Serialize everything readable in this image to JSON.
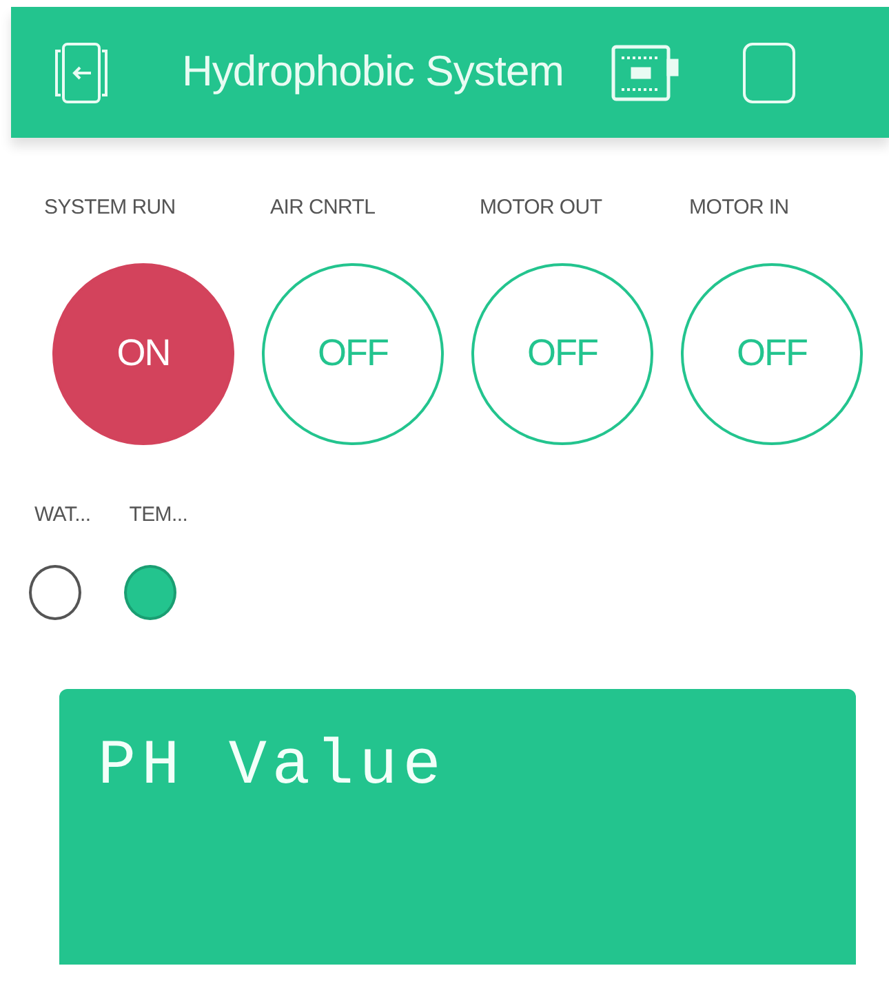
{
  "header": {
    "title": "Hydrophobic System"
  },
  "buttons": [
    {
      "label": "SYSTEM RUN",
      "text": "ON",
      "on": true
    },
    {
      "label": "AIR CNRTL",
      "text": "OFF",
      "on": false
    },
    {
      "label": "MOTOR OUT",
      "text": "OFF",
      "on": false
    },
    {
      "label": "MOTOR IN",
      "text": "OFF",
      "on": false
    }
  ],
  "leds": [
    {
      "label": "WAT...",
      "on": false
    },
    {
      "label": "TEM...",
      "on": true
    }
  ],
  "lcd": {
    "lines": [
      "PH Value"
    ]
  }
}
